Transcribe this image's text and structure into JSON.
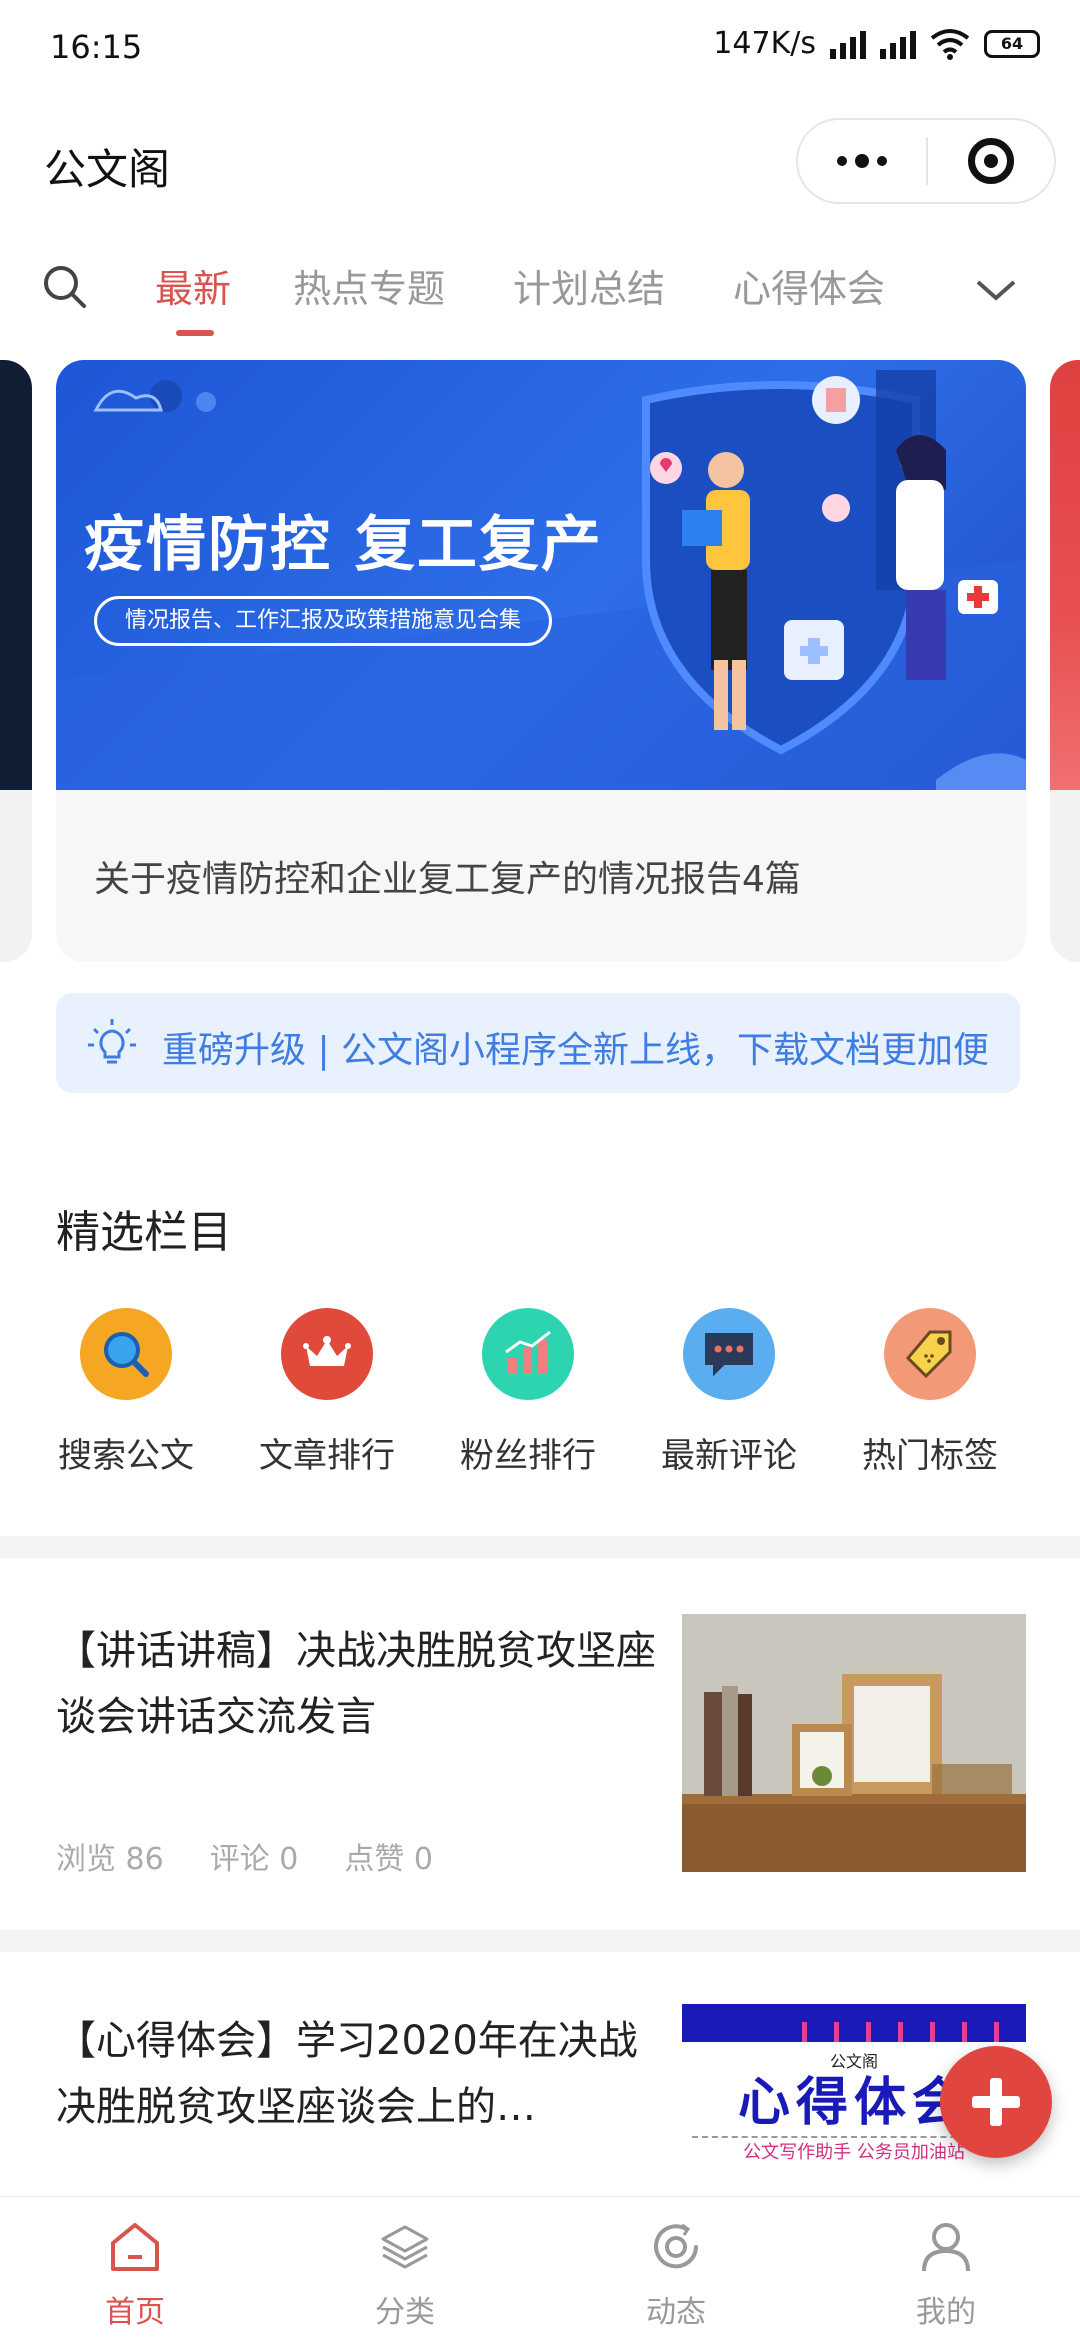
{
  "status_bar": {
    "time": "16:15",
    "speed": "147K/s",
    "battery": "64"
  },
  "header": {
    "title": "公文阁"
  },
  "tabs": [
    "最新",
    "热点专题",
    "计划总结",
    "心得体会"
  ],
  "banner": {
    "headline": "疫情防控 复工复产",
    "pill": "情况报告、工作汇报及政策措施意见合集",
    "caption": "关于疫情防控和企业复工复产的情况报告4篇"
  },
  "notice": {
    "text": "重磅升级 | 公文阁小程序全新上线，下载文档更加便"
  },
  "featured": {
    "title": "精选栏目",
    "items": [
      {
        "label": "搜索公文",
        "icon": "search-icon",
        "color": "#f5a623"
      },
      {
        "label": "文章排行",
        "icon": "crown-icon",
        "color": "#e04a3a"
      },
      {
        "label": "粉丝排行",
        "icon": "chart-icon",
        "color": "#2dd4b0"
      },
      {
        "label": "最新评论",
        "icon": "comment-icon",
        "color": "#5aaef0"
      },
      {
        "label": "热门标签",
        "icon": "tag-icon",
        "color": "#f29a77"
      }
    ]
  },
  "articles": [
    {
      "title": "【讲话讲稿】决战决胜脱贫攻坚座谈会讲话交流发言",
      "views_label": "浏览 86",
      "comments_label": "评论 0",
      "likes_label": "点赞 0"
    },
    {
      "title": "【心得体会】学习2020年在决战决胜脱贫攻坚座谈会上的…",
      "thumb_small": "公文阁",
      "thumb_big": "心得体会",
      "thumb_footer": "公文写作助手 公务员加油站"
    }
  ],
  "tabbar": [
    "首页",
    "分类",
    "动态",
    "我的"
  ],
  "colors": {
    "accent": "#d9534f",
    "notice_text": "#3f7ee0",
    "fab": "#e0463f"
  }
}
